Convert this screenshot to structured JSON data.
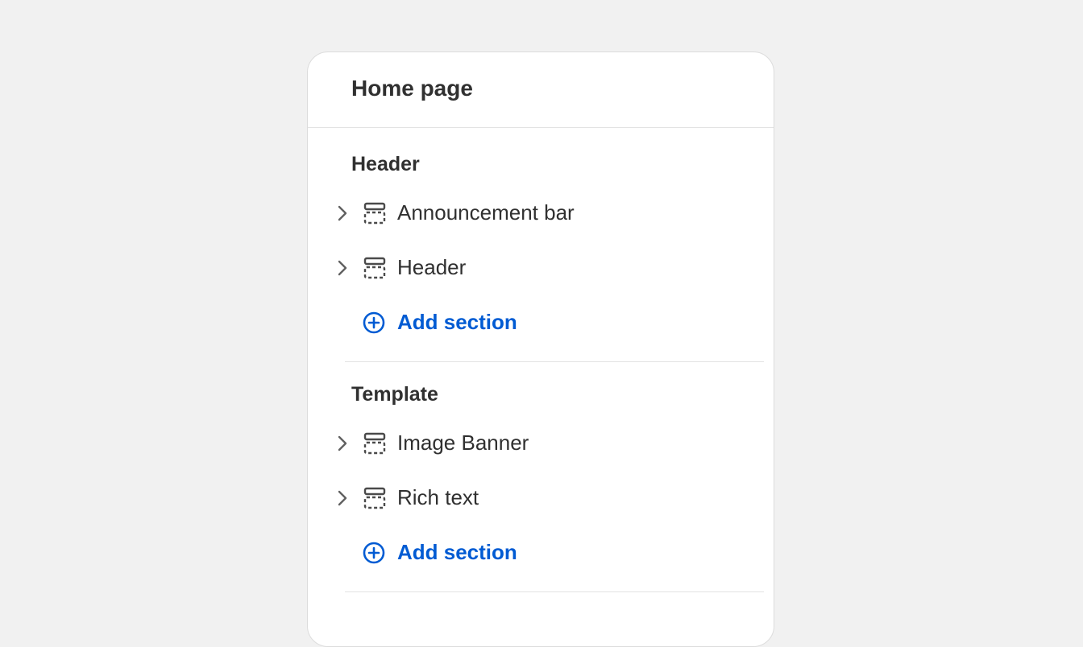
{
  "panel": {
    "title": "Home page"
  },
  "groups": [
    {
      "title": "Header",
      "items": [
        {
          "label": "Announcement bar",
          "icon": "section-icon"
        },
        {
          "label": "Header",
          "icon": "section-icon"
        }
      ],
      "add_label": "Add section"
    },
    {
      "title": "Template",
      "items": [
        {
          "label": "Image Banner",
          "icon": "section-icon"
        },
        {
          "label": "Rich text",
          "icon": "section-icon"
        }
      ],
      "add_label": "Add section"
    }
  ],
  "colors": {
    "accent": "#005bd3",
    "text": "#303030",
    "background": "#f1f1f1"
  }
}
